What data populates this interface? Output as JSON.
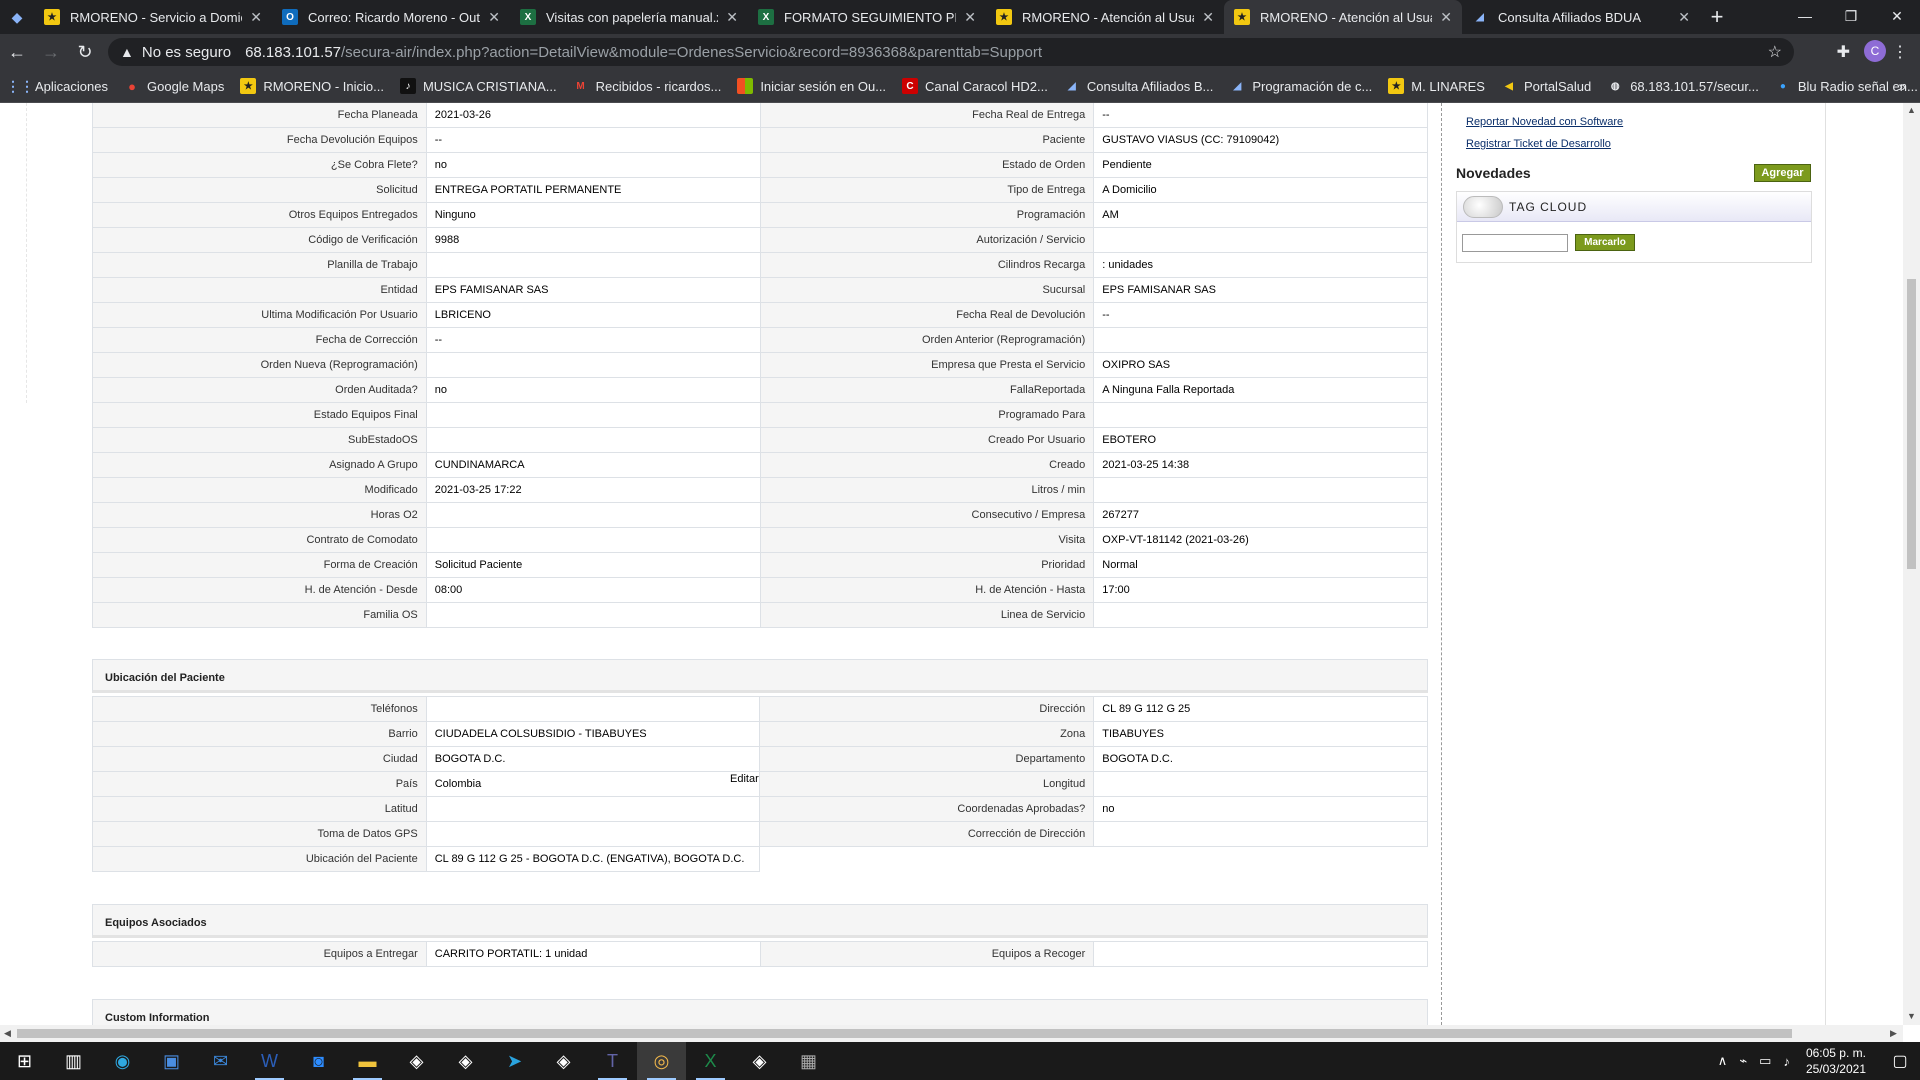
{
  "browser": {
    "tabs": [
      {
        "title": "RMORENO - Servicio a Domicilio",
        "icon": "yellow-square-icon",
        "active": false
      },
      {
        "title": "Correo: Ricardo Moreno - Outlook",
        "icon": "outlook-icon",
        "active": false
      },
      {
        "title": "Visitas con papelería manual.xlsx",
        "icon": "excel-icon",
        "active": false
      },
      {
        "title": "FORMATO SEGUIMIENTO PROGR",
        "icon": "excel-icon",
        "active": false
      },
      {
        "title": "RMORENO - Atención al Usuario",
        "icon": "yellow-square-icon",
        "active": false
      },
      {
        "title": "RMORENO - Atención al Usuario",
        "icon": "yellow-square-icon",
        "active": true
      },
      {
        "title": "Consulta Afiliados BDUA",
        "icon": "bdua-icon",
        "active": false
      }
    ],
    "address": {
      "security": "No es seguro",
      "host": "68.183.101.57",
      "path": "/secura-air/index.php?action=DetailView&module=OrdenesServicio&record=8936368&parenttab=Support"
    },
    "profile_initial": "C",
    "bookmarks": [
      {
        "label": "Aplicaciones",
        "icon": "apps-grid-icon"
      },
      {
        "label": "Google Maps",
        "icon": "maps-pin-icon"
      },
      {
        "label": "RMORENO - Inicio...",
        "icon": "yellow-square-icon"
      },
      {
        "label": "MUSICA CRISTIANA...",
        "icon": "music-icon"
      },
      {
        "label": "Recibidos - ricardos...",
        "icon": "gmail-icon"
      },
      {
        "label": "Iniciar sesión en Ou...",
        "icon": "microsoft-icon"
      },
      {
        "label": "Canal Caracol HD2...",
        "icon": "caracol-icon"
      },
      {
        "label": "Consulta Afiliados B...",
        "icon": "bdua-icon"
      },
      {
        "label": "Programación de c...",
        "icon": "bdua-icon"
      },
      {
        "label": "M. LINARES",
        "icon": "yellow-square-icon"
      },
      {
        "label": "PortalSalud",
        "icon": "portal-icon"
      },
      {
        "label": "68.183.101.57/secur...",
        "icon": "globe-icon"
      },
      {
        "label": "Blu Radio señal en...",
        "icon": "radio-icon"
      }
    ]
  },
  "details": [
    [
      "Fecha Planeada",
      "2021-03-26",
      "Fecha Real de Entrega",
      "--"
    ],
    [
      "Fecha Devolución Equipos",
      "--",
      "Paciente",
      "GUSTAVO VIASUS (CC: 79109042)"
    ],
    [
      "¿Se Cobra Flete?",
      "no",
      "Estado de Orden",
      "Pendiente"
    ],
    [
      "Solicitud",
      "ENTREGA PORTATIL PERMANENTE",
      "Tipo de Entrega",
      "A Domicilio"
    ],
    [
      "Otros Equipos Entregados",
      "Ninguno",
      "Programación",
      "AM"
    ],
    [
      "Código de Verificación",
      "9988",
      "Autorización / Servicio",
      ""
    ],
    [
      "Planilla de Trabajo",
      "",
      "Cilindros Recarga",
      ": unidades"
    ],
    [
      "Entidad",
      "EPS FAMISANAR SAS",
      "Sucursal",
      "EPS FAMISANAR SAS"
    ],
    [
      "Ultima Modificación Por Usuario",
      "LBRICENO",
      "Fecha Real de Devolución",
      "--"
    ],
    [
      "Fecha de Corrección",
      "--",
      "Orden Anterior (Reprogramación)",
      ""
    ],
    [
      "Orden Nueva (Reprogramación)",
      "",
      "Empresa que Presta el Servicio",
      "OXIPRO SAS"
    ],
    [
      "Orden Auditada?",
      "no",
      "FallaReportada",
      "A Ninguna Falla Reportada"
    ],
    [
      "Estado Equipos Final",
      "",
      "Programado Para",
      ""
    ],
    [
      "SubEstadoOS",
      "",
      "Creado Por Usuario",
      "EBOTERO"
    ],
    [
      "Asignado A Grupo",
      "CUNDINAMARCA",
      "Creado",
      "2021-03-25 14:38"
    ],
    [
      "Modificado",
      "2021-03-25 17:22",
      "Litros / min",
      ""
    ],
    [
      "Horas O2",
      "",
      "Consecutivo / Empresa",
      "267277"
    ],
    [
      "Contrato de Comodato",
      "",
      "Visita",
      "OXP-VT-181142 (2021-03-26)"
    ],
    [
      "Forma de Creación",
      "Solicitud Paciente",
      "Prioridad",
      "Normal"
    ],
    [
      "H. de Atención - Desde",
      "08:00",
      "H. de Atención - Hasta",
      "17:00"
    ],
    [
      "Familia OS",
      "",
      "Linea de Servicio",
      ""
    ]
  ],
  "ubicacion": {
    "title": "Ubicación del Paciente",
    "edit_label": "Editar",
    "rows": [
      [
        "Teléfonos",
        "",
        "Dirección",
        "CL 89 G 112 G 25"
      ],
      [
        "Barrio",
        "CIUDADELA COLSUBSIDIO - TIBABUYES",
        "Zona",
        "TIBABUYES"
      ],
      [
        "Ciudad",
        "BOGOTA D.C.",
        "Departamento",
        "BOGOTA D.C."
      ],
      [
        "País",
        "Colombia",
        "Longitud",
        ""
      ],
      [
        "Latitud",
        "",
        "Coordenadas Aprobadas?",
        "no"
      ],
      [
        "Toma de Datos GPS",
        "",
        "Corrección de Dirección",
        ""
      ]
    ],
    "full_row": [
      "Ubicación del Paciente",
      "CL 89 G 112 G 25 - BOGOTA D.C. (ENGATIVA), BOGOTA D.C."
    ]
  },
  "equipos": {
    "title": "Equipos Asociados",
    "rows": [
      [
        "Equipos a Entregar",
        "CARRITO PORTATIL: 1 unidad",
        "Equipos a Recoger",
        ""
      ]
    ]
  },
  "custom": {
    "title": "Custom Information"
  },
  "sidebar": {
    "links": [
      "Reportar Novedad con Software",
      "Registrar Ticket de Desarrollo"
    ],
    "novedades_title": "Novedades",
    "agregar_label": "Agregar",
    "tag_cloud_title": "TAG CLOUD",
    "marcarlo_label": "Marcarlo",
    "tag_input_value": ""
  },
  "taskbar": {
    "apps": [
      "windows-start-icon",
      "task-view-icon",
      "edge-icon",
      "store-icon",
      "mail-icon",
      "word-icon",
      "zoom-icon",
      "file-explorer-icon",
      "app-icon",
      "app-icon",
      "telegram-icon",
      "app-icon",
      "teams-icon",
      "chrome-icon",
      "excel-icon",
      "app-icon",
      "calculator-icon"
    ],
    "time": "06:05 p. m.",
    "date": "25/03/2021"
  }
}
